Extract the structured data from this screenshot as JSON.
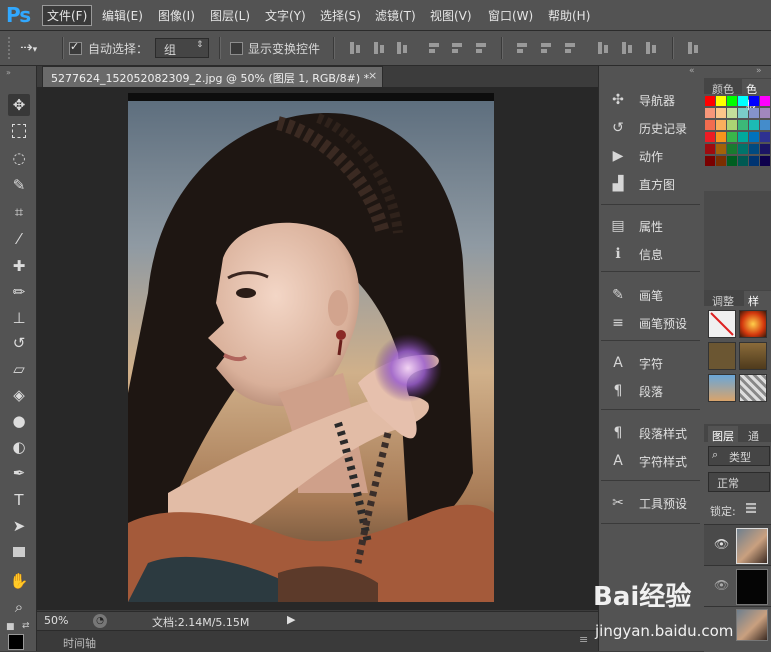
{
  "app": {
    "logo": "Ps"
  },
  "menu": [
    "文件(F)",
    "编辑(E)",
    "图像(I)",
    "图层(L)",
    "文字(Y)",
    "选择(S)",
    "滤镜(T)",
    "视图(V)",
    "窗口(W)",
    "帮助(H)"
  ],
  "options": {
    "auto_select_label": "自动选择：",
    "auto_select_checked": true,
    "auto_select_value": "组",
    "show_transform_label": "显示变换控件"
  },
  "document": {
    "tab_title": "5277624_152052082309_2.jpg @ 50% (图层 1, RGB/8#) *",
    "zoom": "50%",
    "doc_size": "文档:2.14M/5.15M",
    "timeline_label": "时间轴"
  },
  "dock": {
    "groups": [
      [
        {
          "icon": "navigator-icon",
          "glyph": "✣",
          "label": "导航器"
        },
        {
          "icon": "history-icon",
          "glyph": "↺",
          "label": "历史记录"
        },
        {
          "icon": "actions-icon",
          "glyph": "▶",
          "label": "动作"
        },
        {
          "icon": "histogram-icon",
          "glyph": "▟",
          "label": "直方图"
        }
      ],
      [
        {
          "icon": "properties-icon",
          "glyph": "▤",
          "label": "属性"
        },
        {
          "icon": "info-icon",
          "glyph": "ℹ",
          "label": "信息"
        }
      ],
      [
        {
          "icon": "brush-icon",
          "glyph": "✎",
          "label": "画笔"
        },
        {
          "icon": "brush-presets-icon",
          "glyph": "≡",
          "label": "画笔预设"
        }
      ],
      [
        {
          "icon": "character-icon",
          "glyph": "A",
          "label": "字符"
        },
        {
          "icon": "paragraph-icon",
          "glyph": "¶",
          "label": "段落"
        }
      ],
      [
        {
          "icon": "paragraph-styles-icon",
          "glyph": "¶",
          "label": "段落样式"
        },
        {
          "icon": "character-styles-icon",
          "glyph": "A",
          "label": "字符样式"
        }
      ],
      [
        {
          "icon": "tool-presets-icon",
          "glyph": "✂",
          "label": "工具预设"
        }
      ]
    ]
  },
  "right": {
    "color_tabs": [
      "颜色",
      "色板"
    ],
    "adjust_tabs": [
      "调整",
      "样式"
    ],
    "layers_tabs": [
      "图层",
      "通道"
    ],
    "kind_label": "类型",
    "blend_mode": "正常",
    "lock_label": "锁定:"
  },
  "watermark": {
    "text": "Bai经验",
    "url": "jingyan.baidu.com"
  }
}
